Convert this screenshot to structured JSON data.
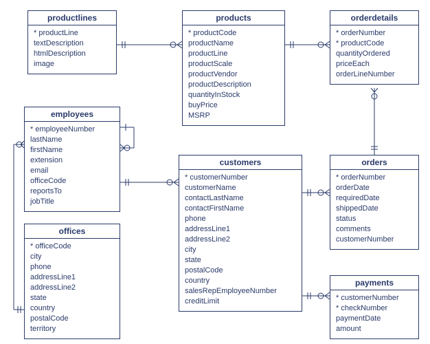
{
  "entities": {
    "productlines": {
      "title": "productlines",
      "attrs": [
        "* productLine",
        "textDescription",
        "htmlDescription",
        "image"
      ]
    },
    "products": {
      "title": "products",
      "attrs": [
        "* productCode",
        "productName",
        "productLine",
        "productScale",
        "productVendor",
        "productDescription",
        "quantityInStock",
        "buyPrice",
        "MSRP"
      ]
    },
    "orderdetails": {
      "title": "orderdetails",
      "attrs": [
        "* orderNumber",
        "* productCode",
        "quantityOrdered",
        "priceEach",
        "orderLineNumber"
      ]
    },
    "employees": {
      "title": "employees",
      "attrs": [
        "* employeeNumber",
        "lastName",
        "firstName",
        "extension",
        "email",
        "officeCode",
        "reportsTo",
        "jobTitle"
      ]
    },
    "customers": {
      "title": "customers",
      "attrs": [
        "* customerNumber",
        "customerName",
        "contactLastName",
        "contactFirstName",
        "phone",
        "addressLine1",
        "addressLine2",
        "city",
        "state",
        "postalCode",
        "country",
        "salesRepEmployeeNumber",
        "creditLimit"
      ]
    },
    "orders": {
      "title": "orders",
      "attrs": [
        "* orderNumber",
        "orderDate",
        "requiredDate",
        "shippedDate",
        "status",
        "comments",
        "customerNumber"
      ]
    },
    "offices": {
      "title": "offices",
      "attrs": [
        "* officeCode",
        "city",
        "phone",
        "addressLine1",
        "addressLine2",
        "state",
        "country",
        "postalCode",
        "territory"
      ]
    },
    "payments": {
      "title": "payments",
      "attrs": [
        "* customerNumber",
        "* checkNumber",
        "paymentDate",
        "amount"
      ]
    }
  }
}
